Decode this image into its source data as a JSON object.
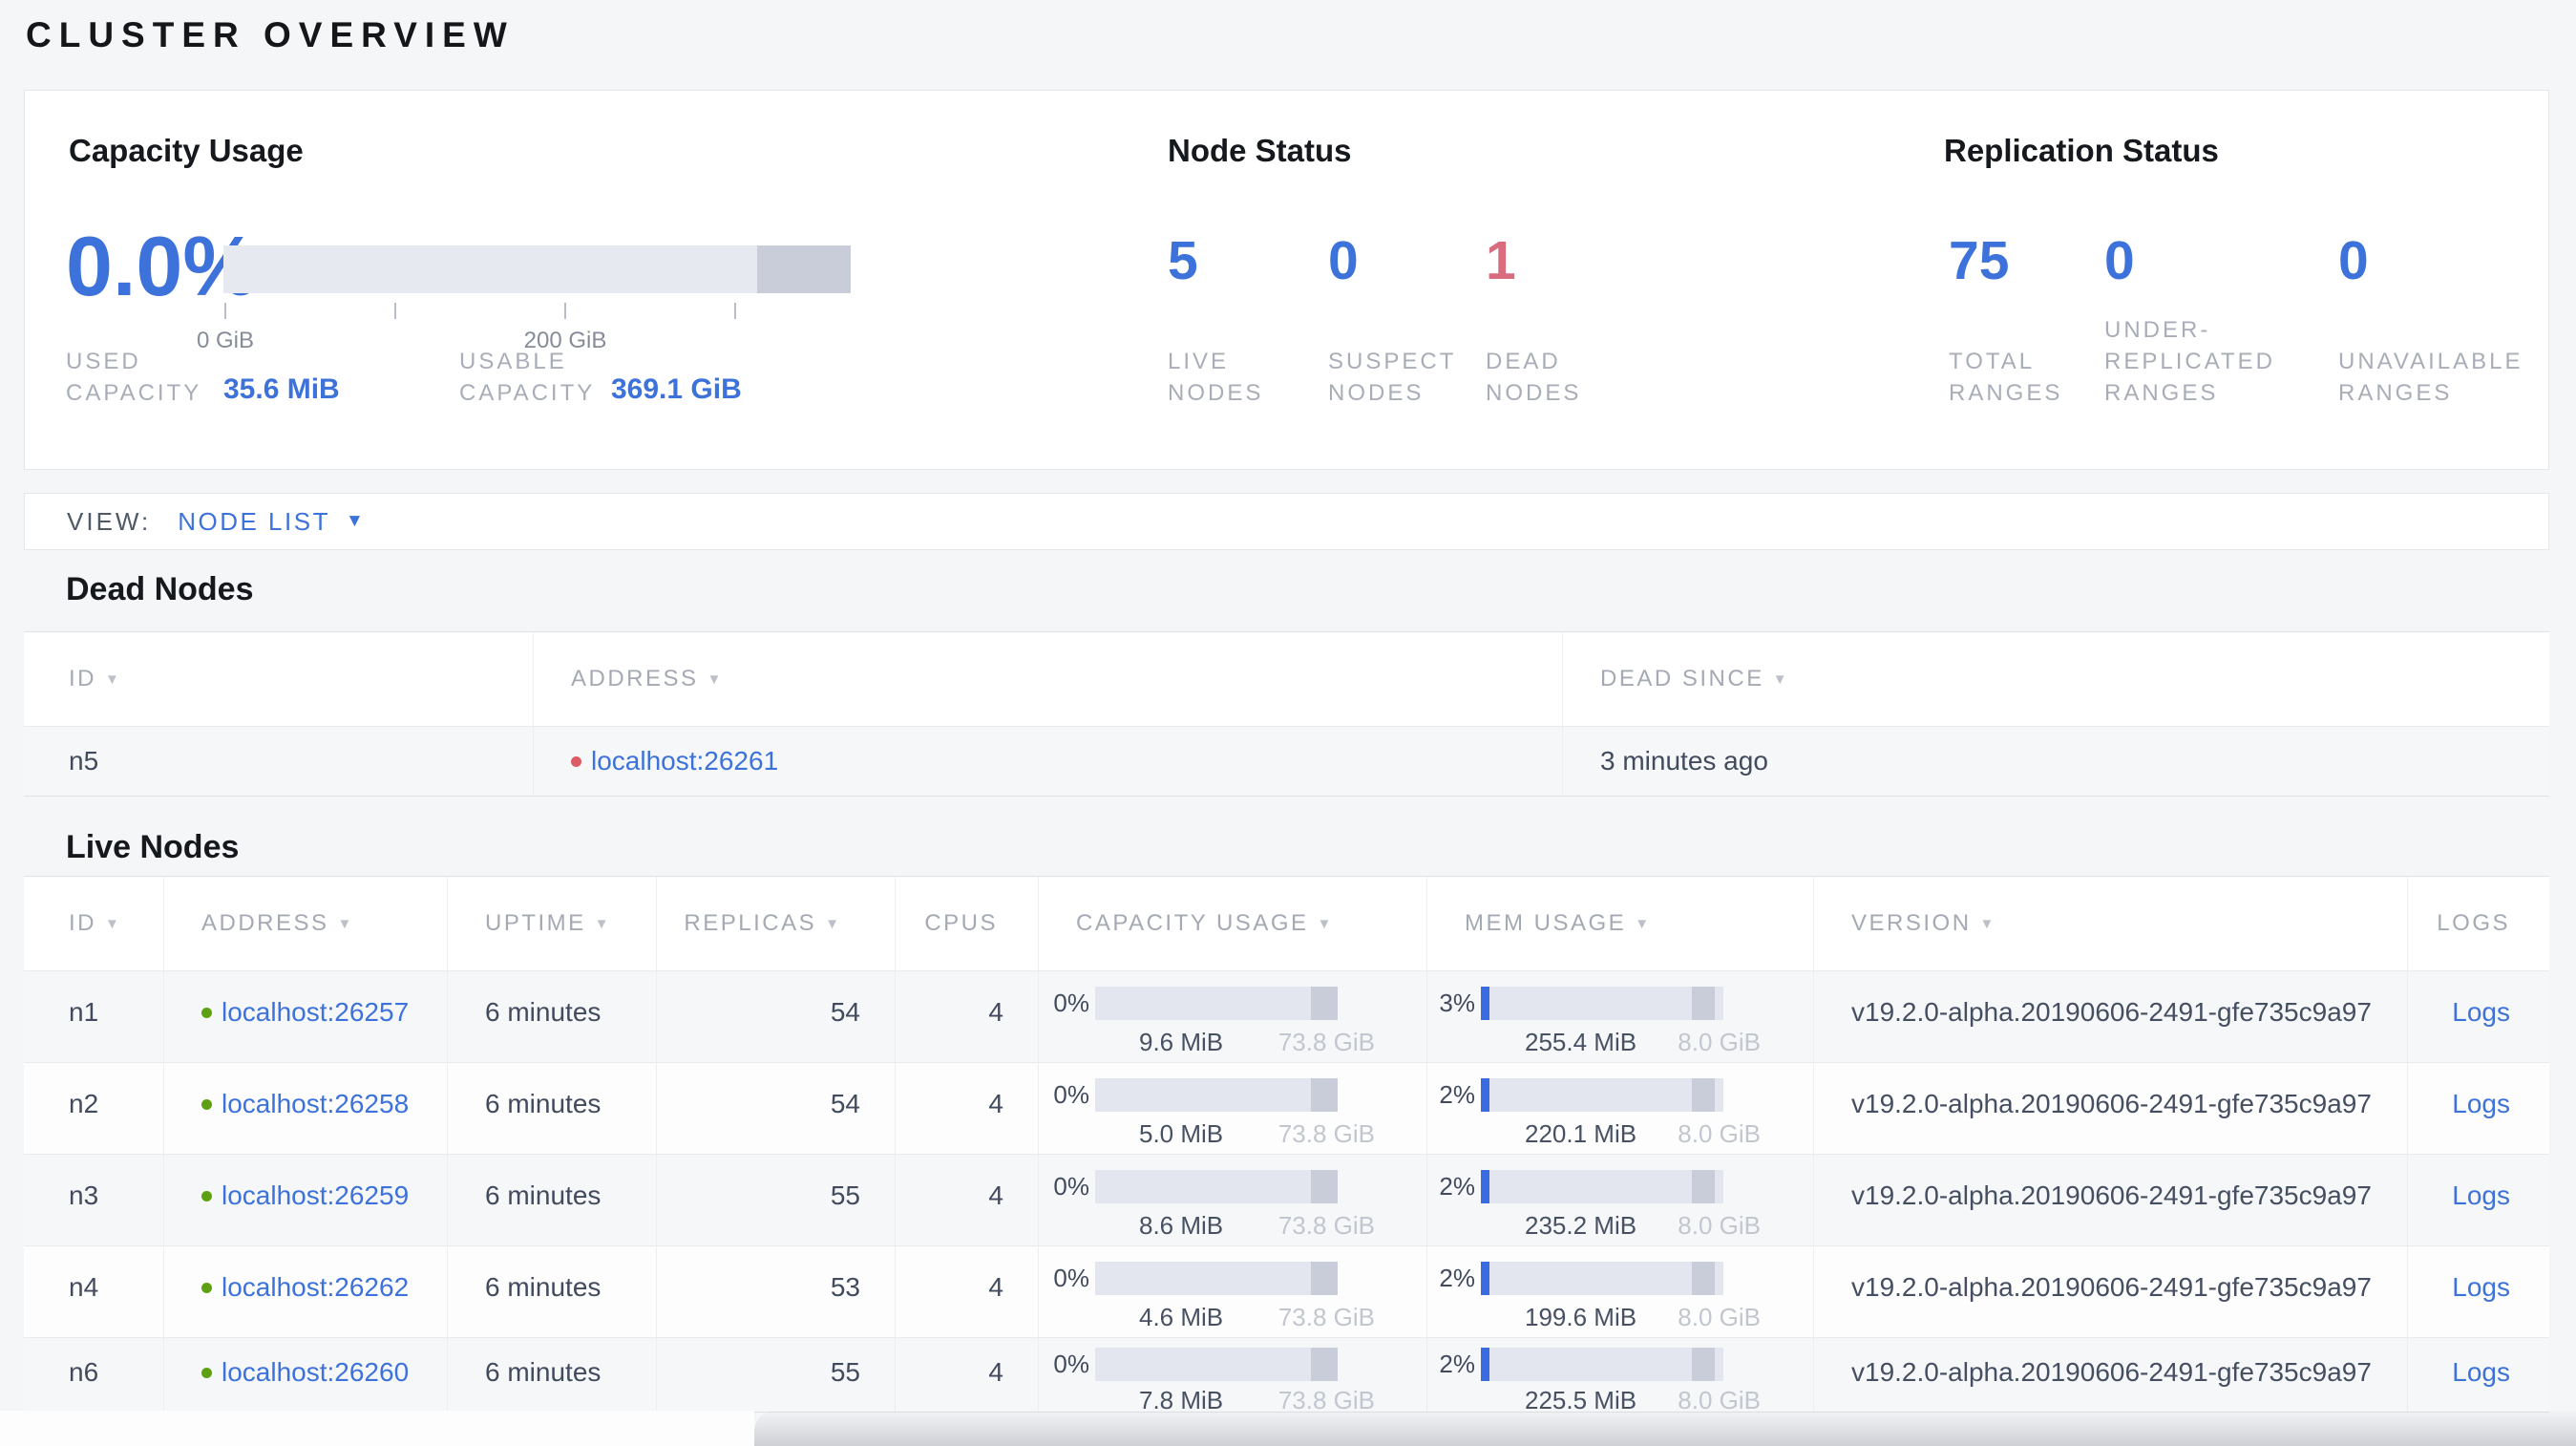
{
  "title": "CLUSTER OVERVIEW",
  "icons": {
    "sort_arrow": "▼",
    "dropdown_caret": "▼"
  },
  "summary": {
    "capacity": {
      "heading": "Capacity Usage",
      "percent": "0.0%",
      "axis": {
        "tick0": "0 GiB",
        "tick200": "200 GiB"
      },
      "used": {
        "line1": "USED",
        "line2": "CAPACITY",
        "value": "35.6 MiB"
      },
      "usable": {
        "line1": "USABLE",
        "line2": "CAPACITY",
        "value": "369.1 GiB"
      }
    },
    "node_status": {
      "heading": "Node Status",
      "stats": [
        {
          "value": "5",
          "line1": "LIVE",
          "line2": "NODES"
        },
        {
          "value": "0",
          "line1": "SUSPECT",
          "line2": "NODES"
        },
        {
          "value": "1",
          "line1": "DEAD",
          "line2": "NODES"
        }
      ]
    },
    "replication": {
      "heading": "Replication Status",
      "stats": [
        {
          "value": "75",
          "line1": "TOTAL",
          "line2": "RANGES"
        },
        {
          "value": "0",
          "line0": "UNDER-",
          "line1": "REPLICATED",
          "line2": "RANGES"
        },
        {
          "value": "0",
          "line1": "UNAVAILABLE",
          "line2": "RANGES"
        }
      ]
    }
  },
  "view_bar": {
    "label": "VIEW:",
    "selected": "NODE LIST"
  },
  "dead_nodes": {
    "heading": "Dead Nodes",
    "columns": {
      "id": "ID",
      "address": "ADDRESS",
      "dead_since": "DEAD SINCE"
    },
    "rows": [
      {
        "id": "n5",
        "address": "localhost:26261",
        "dead_since": "3 minutes ago"
      }
    ]
  },
  "live_nodes": {
    "heading": "Live Nodes",
    "columns": {
      "id": "ID",
      "address": "ADDRESS",
      "uptime": "UPTIME",
      "replicas": "REPLICAS",
      "cpus": "CPUS",
      "capacity": "CAPACITY USAGE",
      "mem": "MEM USAGE",
      "version": "VERSION",
      "logs": "LOGS"
    },
    "rows": [
      {
        "id": "n1",
        "address": "localhost:26257",
        "uptime": "6 minutes",
        "replicas": "54",
        "cpus": "4",
        "capacity_pct": "0%",
        "capacity_used": "9.6 MiB",
        "capacity_total": "73.8 GiB",
        "mem_pct": "3%",
        "mem_used": "255.4 MiB",
        "mem_total": "8.0 GiB",
        "version": "v19.2.0-alpha.20190606-2491-gfe735c9a97",
        "logs": "Logs"
      },
      {
        "id": "n2",
        "address": "localhost:26258",
        "uptime": "6 minutes",
        "replicas": "54",
        "cpus": "4",
        "capacity_pct": "0%",
        "capacity_used": "5.0 MiB",
        "capacity_total": "73.8 GiB",
        "mem_pct": "2%",
        "mem_used": "220.1 MiB",
        "mem_total": "8.0 GiB",
        "version": "v19.2.0-alpha.20190606-2491-gfe735c9a97",
        "logs": "Logs"
      },
      {
        "id": "n3",
        "address": "localhost:26259",
        "uptime": "6 minutes",
        "replicas": "55",
        "cpus": "4",
        "capacity_pct": "0%",
        "capacity_used": "8.6 MiB",
        "capacity_total": "73.8 GiB",
        "mem_pct": "2%",
        "mem_used": "235.2 MiB",
        "mem_total": "8.0 GiB",
        "version": "v19.2.0-alpha.20190606-2491-gfe735c9a97",
        "logs": "Logs"
      },
      {
        "id": "n4",
        "address": "localhost:26262",
        "uptime": "6 minutes",
        "replicas": "53",
        "cpus": "4",
        "capacity_pct": "0%",
        "capacity_used": "4.6 MiB",
        "capacity_total": "73.8 GiB",
        "mem_pct": "2%",
        "mem_used": "199.6 MiB",
        "mem_total": "8.0 GiB",
        "version": "v19.2.0-alpha.20190606-2491-gfe735c9a97",
        "logs": "Logs"
      },
      {
        "id": "n6",
        "address": "localhost:26260",
        "uptime": "6 minutes",
        "replicas": "55",
        "cpus": "4",
        "capacity_pct": "0%",
        "capacity_used": "7.8 MiB",
        "capacity_total": "73.8 GiB",
        "mem_pct": "2%",
        "mem_used": "225.5 MiB",
        "mem_total": "8.0 GiB",
        "version": "v19.2.0-alpha.20190606-2491-gfe735c9a97",
        "logs": "Logs"
      }
    ]
  }
}
